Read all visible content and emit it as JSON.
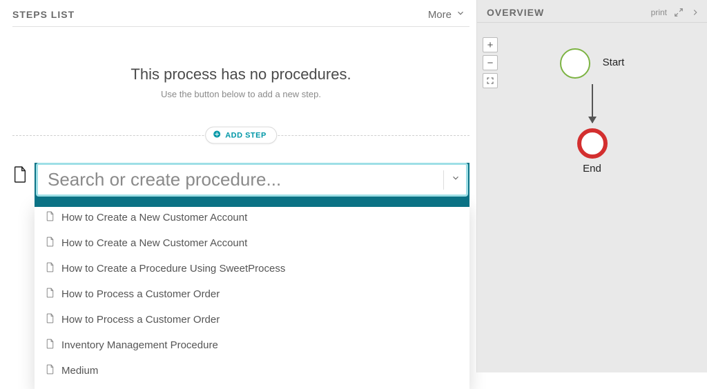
{
  "left": {
    "title": "STEPS LIST",
    "more": "More",
    "empty_title": "This process has no procedures.",
    "empty_sub": "Use the button below to add a new step.",
    "add_step": "ADD STEP",
    "search_placeholder": "Search or create procedure...",
    "procedures": [
      "How to Create a New Customer Account",
      "How to Create a New Customer Account",
      "How to Create a Procedure Using SweetProcess",
      "How to Process a Customer Order",
      "How to Process a Customer Order",
      "Inventory Management Procedure",
      "Medium"
    ]
  },
  "right": {
    "title": "OVERVIEW",
    "print": "print",
    "start_label": "Start",
    "end_label": "End",
    "zoom": {
      "plus": "+",
      "minus": "−"
    }
  }
}
